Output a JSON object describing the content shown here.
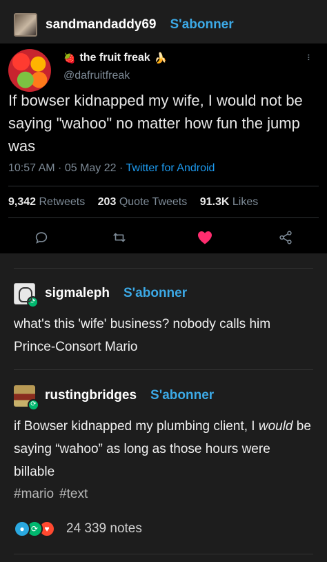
{
  "post": {
    "username": "sandmandaddy69",
    "follow_label": "S'abonner"
  },
  "tweet": {
    "name": "the fruit freak",
    "name_emoji_left": "🍓",
    "name_emoji_right": "🍌",
    "handle": "@dafruitfreak",
    "text": "If bowser kidnapped my wife, I would not be saying \"wahoo\" no matter how fun the jump was",
    "meta_time": "10:57 AM · 05 May 22 · ",
    "meta_source": "Twitter for Android",
    "retweets_count": "9,342",
    "retweets_label": "Retweets",
    "quotes_count": "203",
    "quotes_label": "Quote Tweets",
    "likes_count": "91.3K",
    "likes_label": "Likes",
    "colors": {
      "like": "#ff2d6f",
      "link": "#1d9bf0"
    }
  },
  "reblogs": [
    {
      "username": "sigmaleph",
      "follow_label": "S'abonner",
      "text": "what's this 'wife' business? nobody calls him Prince-Consort Mario"
    },
    {
      "username": "rustingbridges",
      "follow_label": "S'abonner",
      "text_before": "if Bowser kidnapped my plumbing client, I ",
      "text_em": "would",
      "text_after": " be saying “wahoo” as long as those hours were billable"
    }
  ],
  "tags": [
    "#mario",
    "#text"
  ],
  "notes": {
    "label": "24 339 notes",
    "colors": {
      "reply": "#2aa8e0",
      "reblog": "#00b76e",
      "like": "#ff4930"
    }
  },
  "accent_color": "#3ca9e6"
}
